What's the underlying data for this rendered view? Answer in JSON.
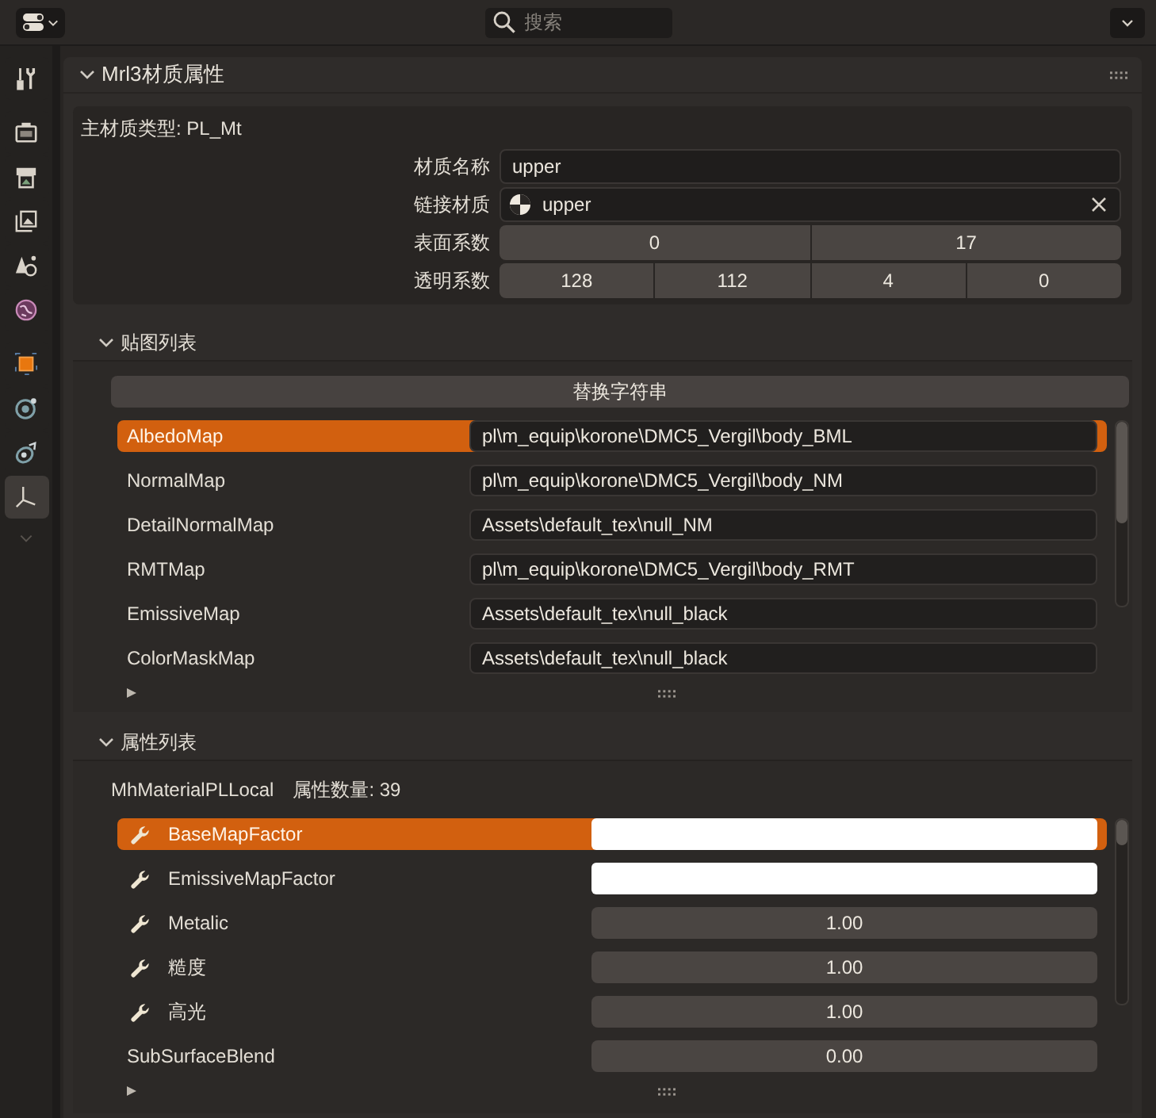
{
  "header": {
    "search": {
      "placeholder": "搜索"
    }
  },
  "sidebar": {
    "groups": [
      [
        {
          "kind": "tool",
          "selected": false
        }
      ],
      [
        {
          "kind": "render",
          "selected": false
        },
        {
          "kind": "output",
          "selected": false
        },
        {
          "kind": "view_layer",
          "selected": false
        },
        {
          "kind": "scene",
          "selected": false
        },
        {
          "kind": "world",
          "selected": false
        }
      ],
      [
        {
          "kind": "object",
          "selected": false
        },
        {
          "kind": "physics",
          "selected": false
        },
        {
          "kind": "constraints",
          "selected": false
        },
        {
          "kind": "data",
          "selected": true
        }
      ]
    ]
  },
  "panel": {
    "title": "Mrl3材质属性",
    "expanded": true,
    "material_type": "主材质类型: PL_Mt",
    "fields": [
      {
        "kind": "text",
        "label": "材质名称",
        "value": "upper"
      },
      {
        "kind": "link",
        "label": "链接材质",
        "value": "upper"
      },
      {
        "kind": "numbers",
        "label": "表面系数",
        "values": [
          "0",
          "17"
        ]
      },
      {
        "kind": "numbers",
        "label": "透明系数",
        "values": [
          "128",
          "112",
          "4",
          "0"
        ]
      }
    ],
    "texture_list": {
      "title": "贴图列表",
      "expanded": true,
      "button": "替换字符串",
      "rows": [
        {
          "name": "AlbedoMap",
          "path": "pl\\m_equip\\korone\\DMC5_Vergil\\body_BML",
          "selected": true
        },
        {
          "name": "NormalMap",
          "path": "pl\\m_equip\\korone\\DMC5_Vergil\\body_NM",
          "selected": false
        },
        {
          "name": "DetailNormalMap",
          "path": "Assets\\default_tex\\null_NM",
          "selected": false
        },
        {
          "name": "RMTMap",
          "path": "pl\\m_equip\\korone\\DMC5_Vergil\\body_RMT",
          "selected": false
        },
        {
          "name": "EmissiveMap",
          "path": "Assets\\default_tex\\null_black",
          "selected": false
        },
        {
          "name": "ColorMaskMap",
          "path": "Assets\\default_tex\\null_black",
          "selected": false
        }
      ]
    },
    "property_list": {
      "title": "属性列表",
      "expanded": true,
      "class_name": "MhMaterialPLLocal",
      "count": "属性数量: 39",
      "rows": [
        {
          "kind": "color",
          "name": "BaseMapFactor",
          "has_icon": true,
          "color": "#ffffff",
          "selected": true
        },
        {
          "kind": "color",
          "name": "EmissiveMapFactor",
          "has_icon": true,
          "color": "#ffffff",
          "selected": false
        },
        {
          "kind": "number",
          "name": "Metalic",
          "has_icon": true,
          "value": "1.00",
          "selected": false
        },
        {
          "kind": "number",
          "name": "糙度",
          "has_icon": true,
          "value": "1.00",
          "selected": false
        },
        {
          "kind": "number",
          "name": "高光",
          "has_icon": true,
          "value": "1.00",
          "selected": false
        },
        {
          "kind": "number",
          "name": "SubSurfaceBlend",
          "has_icon": false,
          "value": "0.00",
          "selected": false
        }
      ]
    }
  }
}
